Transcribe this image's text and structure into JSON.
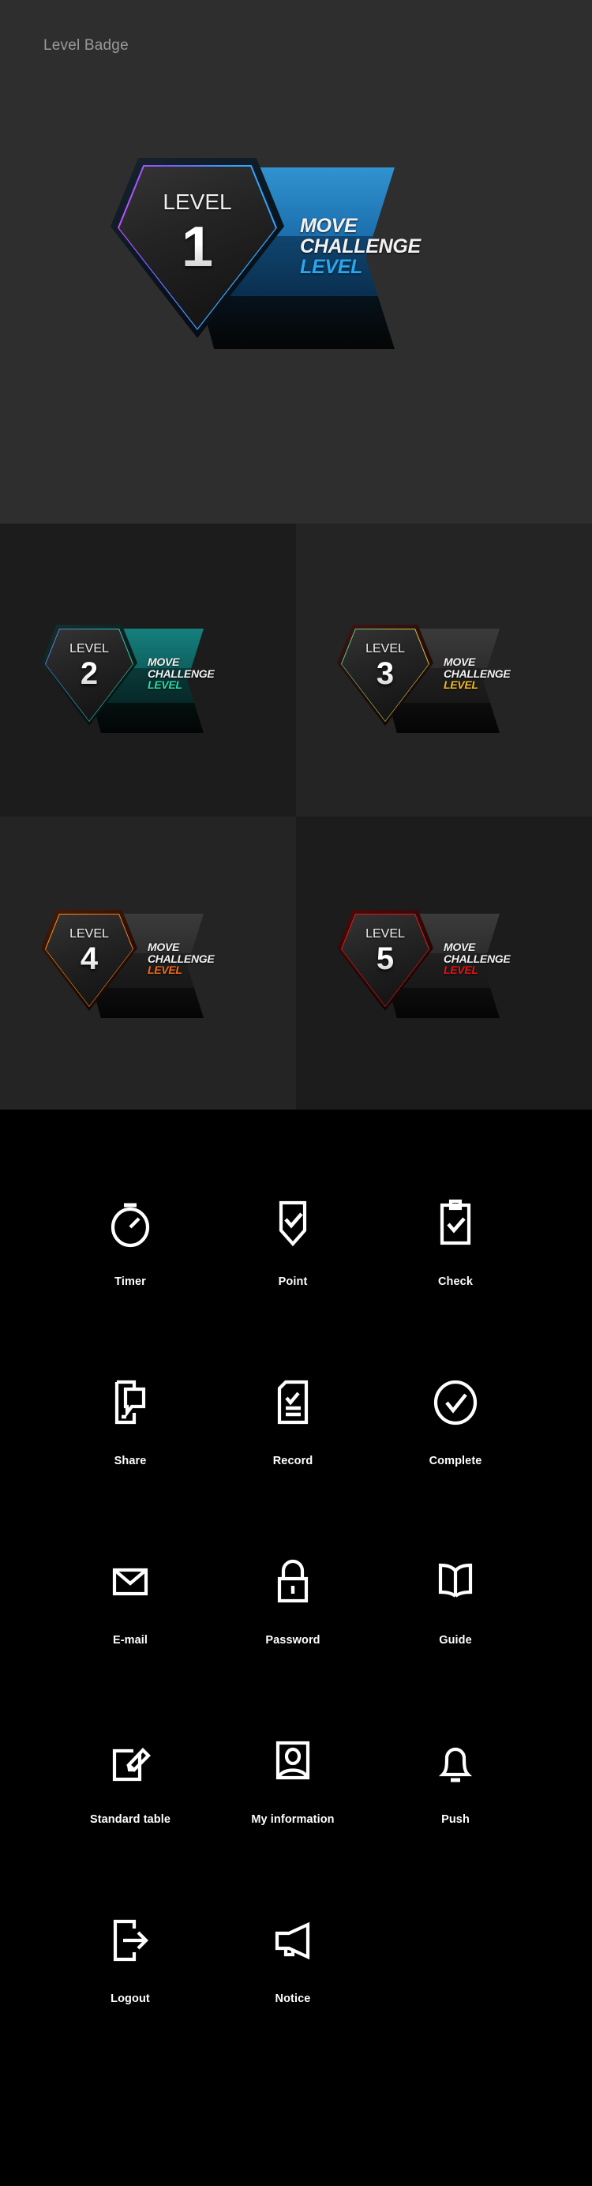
{
  "hero": {
    "title": "Level Badge",
    "badge": {
      "level_word": "LEVEL",
      "level_number": "1",
      "ribbon_line1": "MOVE",
      "ribbon_line2": "CHALLENGE",
      "ribbon_line3": "LEVEL",
      "accent_left": "#d24cff",
      "accent_right": "#2fa8ff",
      "ribbon_color": "#1e7fc2",
      "ribbon_accent_text": "#28a7ef"
    }
  },
  "grid": {
    "badges": [
      {
        "level_word": "LEVEL",
        "level_number": "2",
        "ribbon_line1": "MOVE",
        "ribbon_line2": "CHALLENGE",
        "ribbon_line3": "LEVEL",
        "accent_left": "#6a6ad8",
        "accent_right": "#27d8a8",
        "ribbon_color": "#127a78",
        "ribbon_accent_text": "#27dfa5",
        "glow": "#0c4a48"
      },
      {
        "level_word": "LEVEL",
        "level_number": "3",
        "ribbon_line1": "MOVE",
        "ribbon_line2": "CHALLENGE",
        "ribbon_line3": "LEVEL",
        "accent_left": "#35c98f",
        "accent_right": "#f0bf1c",
        "ribbon_color": "#2b2b2b",
        "ribbon_accent_text": "#f2b81b",
        "glow": "#3a1414"
      },
      {
        "level_word": "LEVEL",
        "level_number": "4",
        "ribbon_line1": "MOVE",
        "ribbon_line2": "CHALLENGE",
        "ribbon_line3": "LEVEL",
        "accent_left": "#e88f20",
        "accent_right": "#f07a10",
        "ribbon_color": "#2b2b2b",
        "ribbon_accent_text": "#f26a12",
        "glow": "#3d1606"
      },
      {
        "level_word": "LEVEL",
        "level_number": "5",
        "ribbon_line1": "MOVE",
        "ribbon_line2": "CHALLENGE",
        "ribbon_line3": "LEVEL",
        "accent_left": "#e01a1a",
        "accent_right": "#e01a1a",
        "ribbon_color": "#2b2b2b",
        "ribbon_accent_text": "#ea1313",
        "glow": "#3d0808"
      }
    ]
  },
  "icons": {
    "rows": [
      [
        {
          "label": "Timer",
          "icon": "stopwatch-icon"
        },
        {
          "label": "Point",
          "icon": "shield-check-icon"
        },
        {
          "label": "Check",
          "icon": "clipboard-check-icon"
        }
      ],
      [
        {
          "label": "Share",
          "icon": "phone-share-icon"
        },
        {
          "label": "Record",
          "icon": "document-check-icon"
        },
        {
          "label": "Complete",
          "icon": "circle-check-icon"
        }
      ],
      [
        {
          "label": "E-mail",
          "icon": "envelope-icon"
        },
        {
          "label": "Password",
          "icon": "lock-icon"
        },
        {
          "label": "Guide",
          "icon": "open-book-icon"
        }
      ],
      [
        {
          "label": "Standard table",
          "icon": "pencil-edit-icon"
        },
        {
          "label": "My information",
          "icon": "user-portrait-icon"
        },
        {
          "label": "Push",
          "icon": "bell-icon"
        }
      ],
      [
        {
          "label": "Logout",
          "icon": "logout-door-icon"
        },
        {
          "label": "Notice",
          "icon": "megaphone-icon"
        }
      ]
    ]
  }
}
